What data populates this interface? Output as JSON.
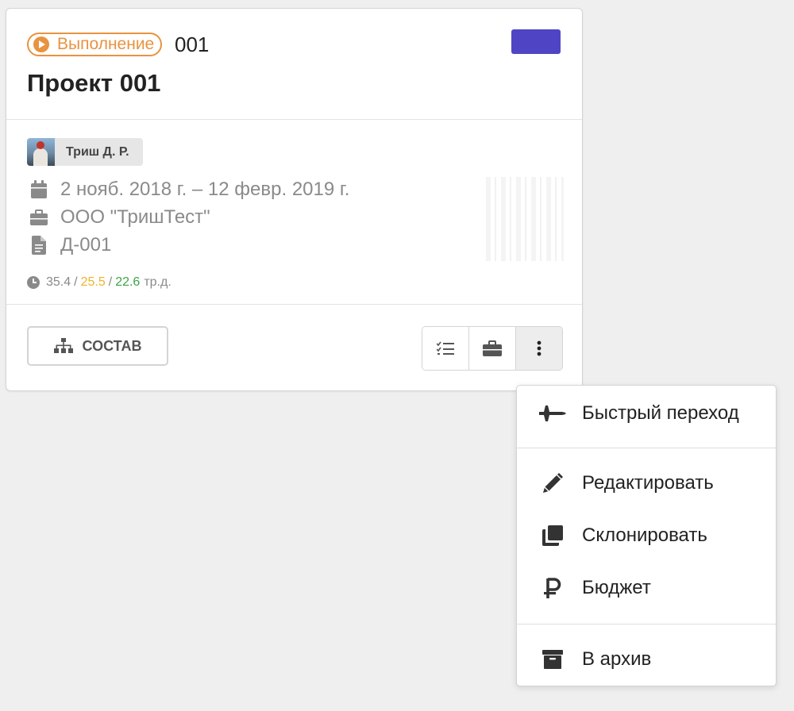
{
  "card": {
    "status": "Выполнение",
    "code": "001",
    "title": "Проект 001",
    "color": "#4f45c4",
    "assignee": "Триш Д. Р.",
    "dates": "2 нояб. 2018 г. – 12 февр. 2019 г.",
    "client": "ООО \"ТришТест\"",
    "contract": "Д-001",
    "hours": {
      "total": "35.4",
      "spent": "25.5",
      "remaining": "22.6",
      "unit": "тр.д.",
      "separator": "/"
    },
    "composition_label": "СОСТАВ"
  },
  "action_buttons": [
    {
      "icon": "checklist-icon"
    },
    {
      "icon": "briefcase-icon"
    },
    {
      "icon": "more-vertical-icon"
    }
  ],
  "menu": {
    "items": [
      {
        "label": "Быстрый переход",
        "icon": "airplane-icon"
      },
      {
        "label": "Редактировать",
        "icon": "pencil-icon"
      },
      {
        "label": "Склонировать",
        "icon": "clone-icon"
      },
      {
        "label": "Бюджет",
        "icon": "ruble-icon"
      },
      {
        "label": "В архив",
        "icon": "archive-icon"
      }
    ]
  },
  "colors": {
    "status": "#e8933f",
    "accent": "#4f45c4",
    "hours_spent": "#f0b429",
    "hours_remaining": "#3aa646"
  }
}
